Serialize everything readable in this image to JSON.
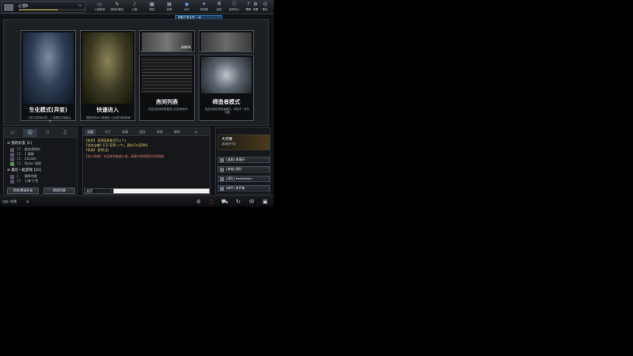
{
  "player": {
    "name": "心悦Ⅱ",
    "level": "Lv."
  },
  "xp_progress": 0.6,
  "nav": [
    {
      "label": "火线竞技",
      "icon": "monitor-icon"
    },
    {
      "label": "游戏大事记",
      "icon": "notepad-icon"
    },
    {
      "label": "公告",
      "icon": "speaker-icon"
    },
    {
      "label": "商店",
      "icon": "shop-icon"
    },
    {
      "label": "仓库",
      "icon": "storage-icon"
    },
    {
      "label": "大厅",
      "icon": "tv-icon"
    },
    {
      "label": "背包库",
      "icon": "ak-icon"
    },
    {
      "label": "战队",
      "icon": "team-icon"
    },
    {
      "label": "活动中心",
      "icon": "activity-icon"
    },
    {
      "label": "帮助",
      "icon": "help-icon"
    },
    {
      "label": "设置",
      "icon": "gear-icon"
    },
    {
      "label": "退出",
      "icon": "power-icon"
    }
  ],
  "ticker": "获取了前五号 ... ▶",
  "modes": [
    {
      "title": "生化模式(异变)",
      "desc": "人类与变异体对抗，人类需坚持到最后一刻"
    },
    {
      "title": "快速进入",
      "desc": "根据您的水平快速进入合适的游戏房间"
    },
    {
      "title": "房间列表",
      "desc": "浏览并选择您想要进入的游戏房间"
    },
    {
      "title": "缔造者模式",
      "desc": "挑战全新的缔造者模式，体验不一样的乐趣"
    }
  ],
  "small_cards": [
    {
      "label": "训练场"
    },
    {
      "label": ""
    }
  ],
  "friends": {
    "tabs": [
      "▭",
      "☺",
      "⚇",
      "♫"
    ],
    "groups": [
      {
        "name": "我的好友",
        "count": "[1]"
      },
      {
        "name": "最近一起游戏",
        "count": "[10]"
      }
    ],
    "rows": [
      {
        "lv": "15",
        "name": "都会想和你"
      },
      {
        "lv": "15",
        "name": "1·凝睇"
      },
      {
        "lv": "15",
        "name": "Zhailoh"
      },
      {
        "lv": "15",
        "name": "Dylan 刚刚"
      },
      {
        "lv": "3",
        "name": "霸辉特勤"
      },
      {
        "lv": "15",
        "name": "刀锋飞·雪"
      }
    ],
    "add_button": "添加/邀请好友",
    "list_button": "群组列表"
  },
  "chat": {
    "tabs": [
      "全部",
      "大厅",
      "私聊",
      "战队",
      "系统",
      "喇叭"
    ],
    "lines": [
      "【房间】 获得英雄复活币(1个)",
      "【战友宝箱】打开 获得 (1个)，真的可以获得吗",
      "【系统】 获得(无)",
      "【战斗系统】 欢迎来到穿越火线，请遵守游戏规则文明游戏"
    ],
    "channel": "大厅",
    "input_placeholder": ""
  },
  "side": {
    "promo_title": "大奖赛",
    "promo_sub": "活动进行中",
    "buttons": [
      "[道具] 邀请码",
      "[商城] 限时",
      "[战队] Newsletter",
      "[邮件] 收件箱"
    ]
  },
  "footer": {
    "status": "在线",
    "icons": [
      "compass-icon",
      "ring-icon",
      "cart-icon",
      "refresh-icon",
      "envelope-icon",
      "calendar-icon"
    ]
  }
}
